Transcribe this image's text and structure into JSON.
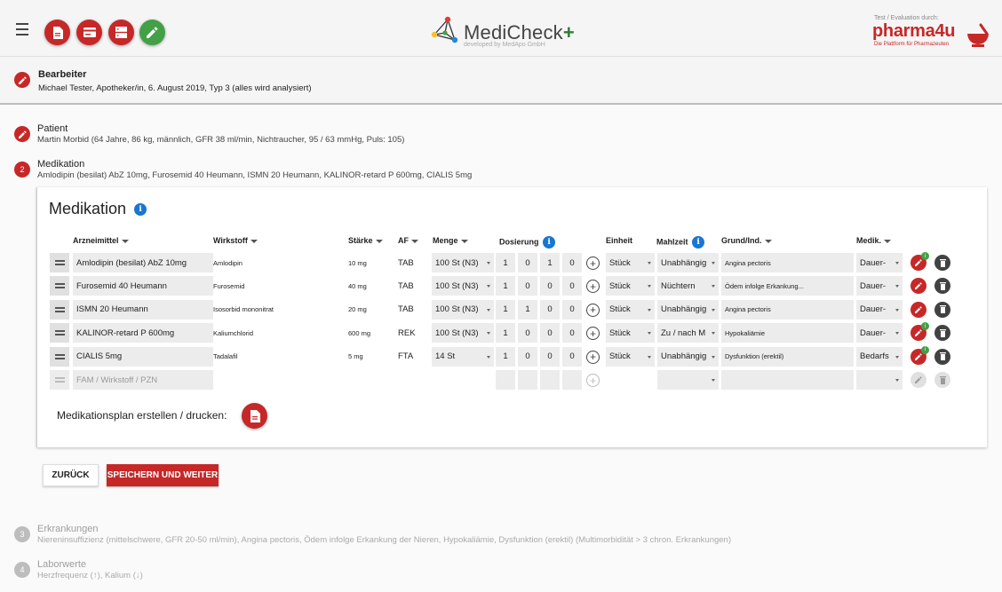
{
  "header": {
    "logo_name": "MediCheck",
    "logo_plus": "+",
    "logo_sub": "developed by MedApo GmbH",
    "partner_test": "Test / Evaluation durch:",
    "partner_name": "pharma4u",
    "partner_tag": "Die Plattform für Pharmazeuten",
    "toolbar_icons": [
      "document-icon",
      "card-icon",
      "storage-icon",
      "pencil-icon"
    ]
  },
  "editor": {
    "title": "Bearbeiter",
    "subtitle": "Michael Tester, Apotheker/in, 6. August 2019, Typ 3 (alles wird analysiert)"
  },
  "steps": [
    {
      "num": "",
      "title": "Patient",
      "subtitle": "Martin Morbid (64 Jahre, 86 kg, männlich, GFR 38 ml/min, Nichtraucher, 95 / 63 mmHg, Puls: 105)"
    },
    {
      "num": "2",
      "title": "Medikation",
      "subtitle": "Amlodipin (besilat) AbZ 10mg, Furosemid 40 Heumann, ISMN 20 Heumann, KALINOR-retard P 600mg, CIALIS 5mg"
    },
    {
      "num": "3",
      "title": "Erkrankungen",
      "subtitle": "Niereninsuffizienz (mittelschwere, GFR 20-50 ml/min), Angina pectoris, Ödem infolge Erkankung der Nieren, Hypokaliämie, Dysfunktion (erektil) (Multimorbidität > 3 chron. Erkrankungen)"
    },
    {
      "num": "4",
      "title": "Laborwerte",
      "subtitle": "Herzfrequenz (↑), Kalium (↓)"
    }
  ],
  "medication": {
    "title": "Medikation",
    "columns": {
      "drug": "Arzneimittel",
      "substance": "Wirkstoff",
      "strength": "Stärke",
      "form": "AF",
      "amount": "Menge",
      "dosage": "Dosierung",
      "unit": "Einheit",
      "meal": "Mahlzeit",
      "reason": "Grund/Ind.",
      "medik": "Medik."
    },
    "rows": [
      {
        "drug": "Amlodipin (besilat) AbZ 10mg",
        "substance": "Amlodipin",
        "strength": "10 mg",
        "form": "TAB",
        "amount": "100 St (N3)",
        "dose": [
          "1",
          "0",
          "1",
          "0"
        ],
        "unit": "Stück",
        "meal": "Unabhängig",
        "reason": "Angina pectoris",
        "medik": "Dauer-",
        "badge": "i"
      },
      {
        "drug": "Furosemid 40 Heumann",
        "substance": "Furosemid",
        "strength": "40 mg",
        "form": "TAB",
        "amount": "100 St (N3)",
        "dose": [
          "1",
          "0",
          "0",
          "0"
        ],
        "unit": "Stück",
        "meal": "Nüchtern",
        "reason": "Ödem infolge Erkankung...",
        "medik": "Dauer-",
        "badge": ""
      },
      {
        "drug": "ISMN 20 Heumann",
        "substance": "Isosorbid mononitrat",
        "strength": "20 mg",
        "form": "TAB",
        "amount": "100 St (N3)",
        "dose": [
          "1",
          "1",
          "0",
          "0"
        ],
        "unit": "Stück",
        "meal": "Unabhängig",
        "reason": "Angina pectoris",
        "medik": "Dauer-",
        "badge": ""
      },
      {
        "drug": "KALINOR-retard P 600mg",
        "substance": "Kaliumchlorid",
        "strength": "600 mg",
        "form": "REK",
        "amount": "100 St (N3)",
        "dose": [
          "1",
          "0",
          "0",
          "0"
        ],
        "unit": "Stück",
        "meal": "Zu / nach M",
        "reason": "Hypokaliämie",
        "medik": "Dauer-",
        "badge": "i"
      },
      {
        "drug": "CIALIS 5mg",
        "substance": "Tadalafil",
        "strength": "5 mg",
        "form": "FTA",
        "amount": "14 St",
        "dose": [
          "1",
          "0",
          "0",
          "0"
        ],
        "unit": "Stück",
        "meal": "Unabhängig",
        "reason": "Dysfunktion (erektil)",
        "medik": "Bedarfs",
        "badge": "i"
      }
    ],
    "new_row_placeholder": "FAM / Wirkstoff / PZN",
    "plan_label": "Medikationsplan erstellen / drucken:"
  },
  "buttons": {
    "back": "ZURÜCK",
    "save": "SPEICHERN UND WEITER"
  },
  "colors": {
    "accent": "#c62828",
    "green": "#43a047",
    "info": "#1976d2"
  }
}
